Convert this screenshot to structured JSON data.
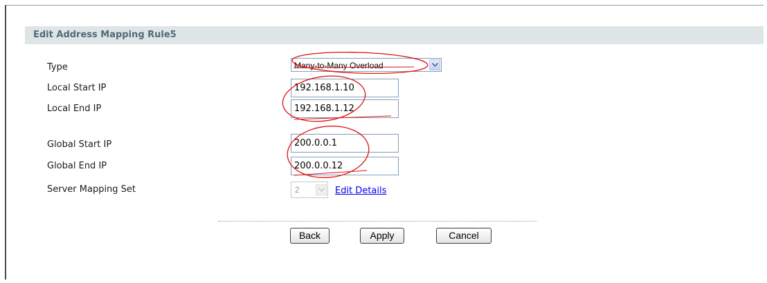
{
  "form": {
    "title": "Edit Address Mapping Rule5",
    "type_label": "Type",
    "type_value": "Many-to-Many Overload",
    "local_start_label": "Local Start IP",
    "local_start_value": "192.168.1.10",
    "local_end_label": "Local End IP",
    "local_end_value": "192.168.1.12",
    "global_start_label": "Global Start IP",
    "global_start_value": "200.0.0.1",
    "global_end_label": "Global End IP",
    "global_end_value": "200.0.0.12",
    "server_mapping_label": "Server Mapping Set",
    "server_mapping_value": "2",
    "edit_details_label": "Edit Details"
  },
  "buttons": {
    "back": "Back",
    "apply": "Apply",
    "cancel": "Cancel"
  },
  "colors": {
    "annotation": "#e01010",
    "title_text": "#4f6a78",
    "title_bar": "#dfe4e6",
    "link": "#0000ee"
  },
  "icons": {
    "dropdown": "chevron-down-icon",
    "annotation": "red-circle-annotation"
  }
}
